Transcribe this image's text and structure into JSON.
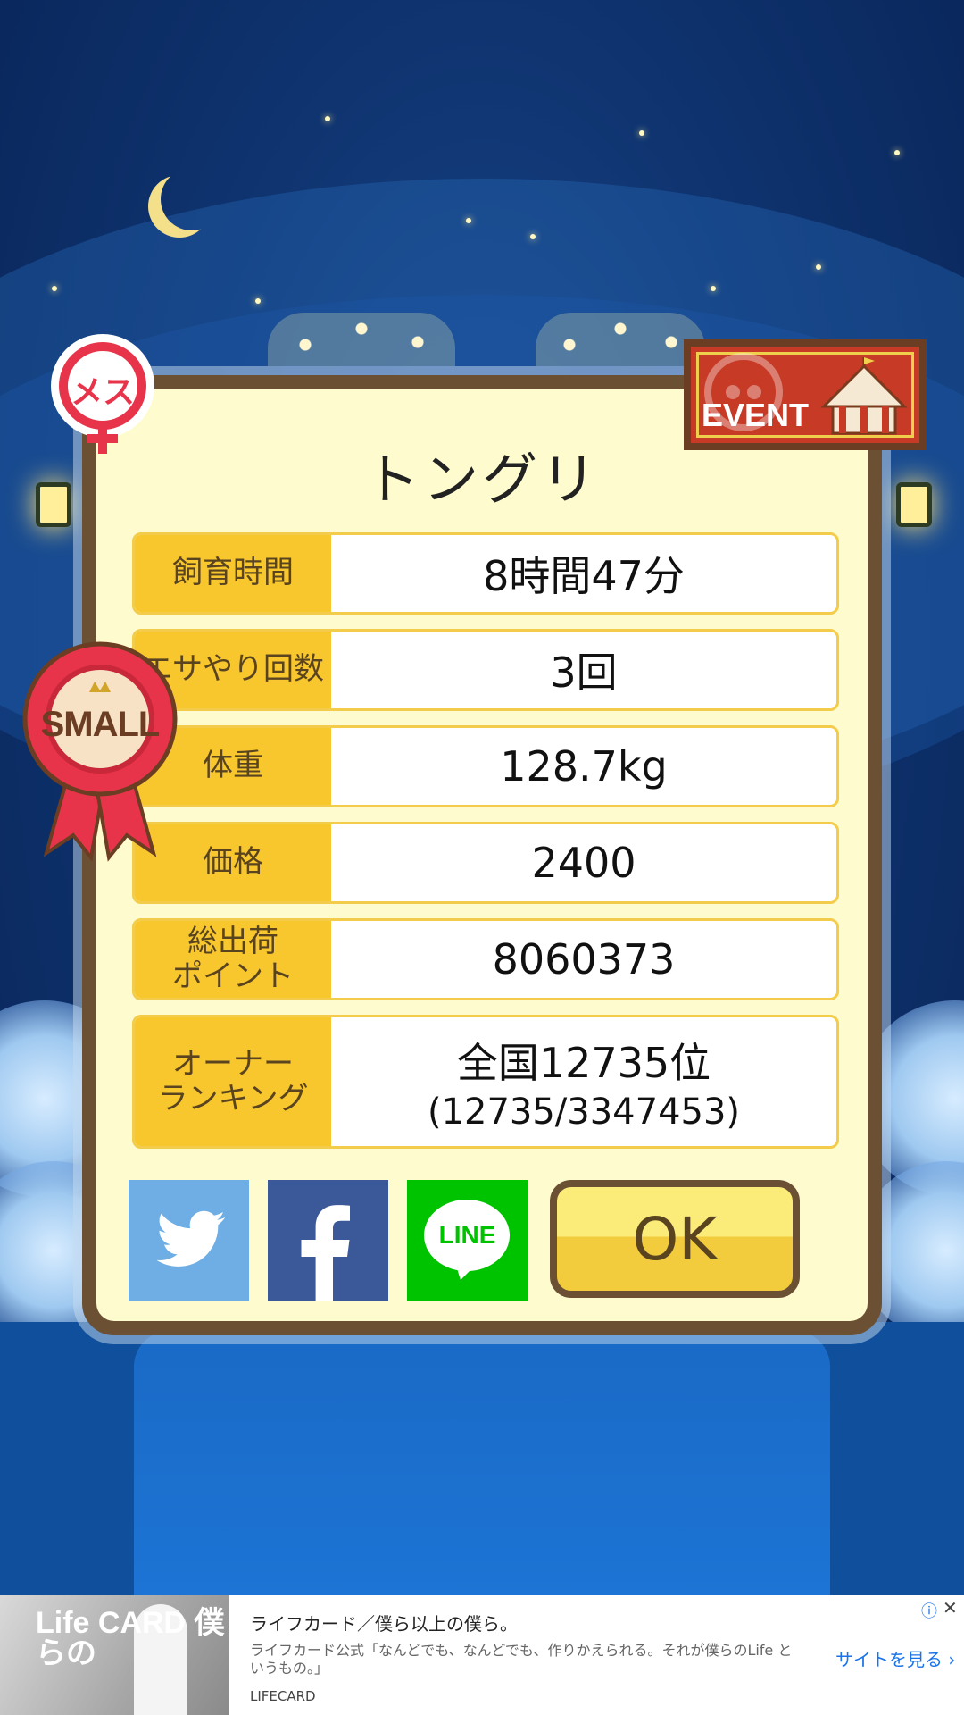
{
  "pig": {
    "name": "トングリ",
    "gender_label": "メス",
    "event_label": "EVENT",
    "size_label": "SMALL"
  },
  "stats": [
    {
      "label": "飼育時間",
      "value": "8時間47分"
    },
    {
      "label": "エサやり回数",
      "value": "3回"
    },
    {
      "label": "体重",
      "value": "128.7kg"
    },
    {
      "label": "価格",
      "value": "2400"
    },
    {
      "label": "総出荷\nポイント",
      "value": "8060373"
    },
    {
      "label": "オーナー\nランキング",
      "value": "全国12735位",
      "sub": "(12735/3347453)"
    }
  ],
  "share": {
    "twitter_icon": "twitter-icon",
    "facebook_icon": "facebook-icon",
    "line_label": "LINE"
  },
  "ok_label": "OK",
  "ad": {
    "title": "ライフカード／僕ら以上の僕ら。",
    "description": "ライフカード公式「なんどでも、なんどでも、作りかえられる。それが僕らのLife というもの。」",
    "source": "LIFECARD",
    "cta": "サイトを見る",
    "image_text": "Life CARD 僕らの"
  },
  "colors": {
    "dialog_bg": "#fefbcf",
    "label_bg": "#f8c72e",
    "frame": "#6b5033",
    "twitter": "#6eaee4",
    "facebook": "#3b5998",
    "line": "#00c300"
  }
}
